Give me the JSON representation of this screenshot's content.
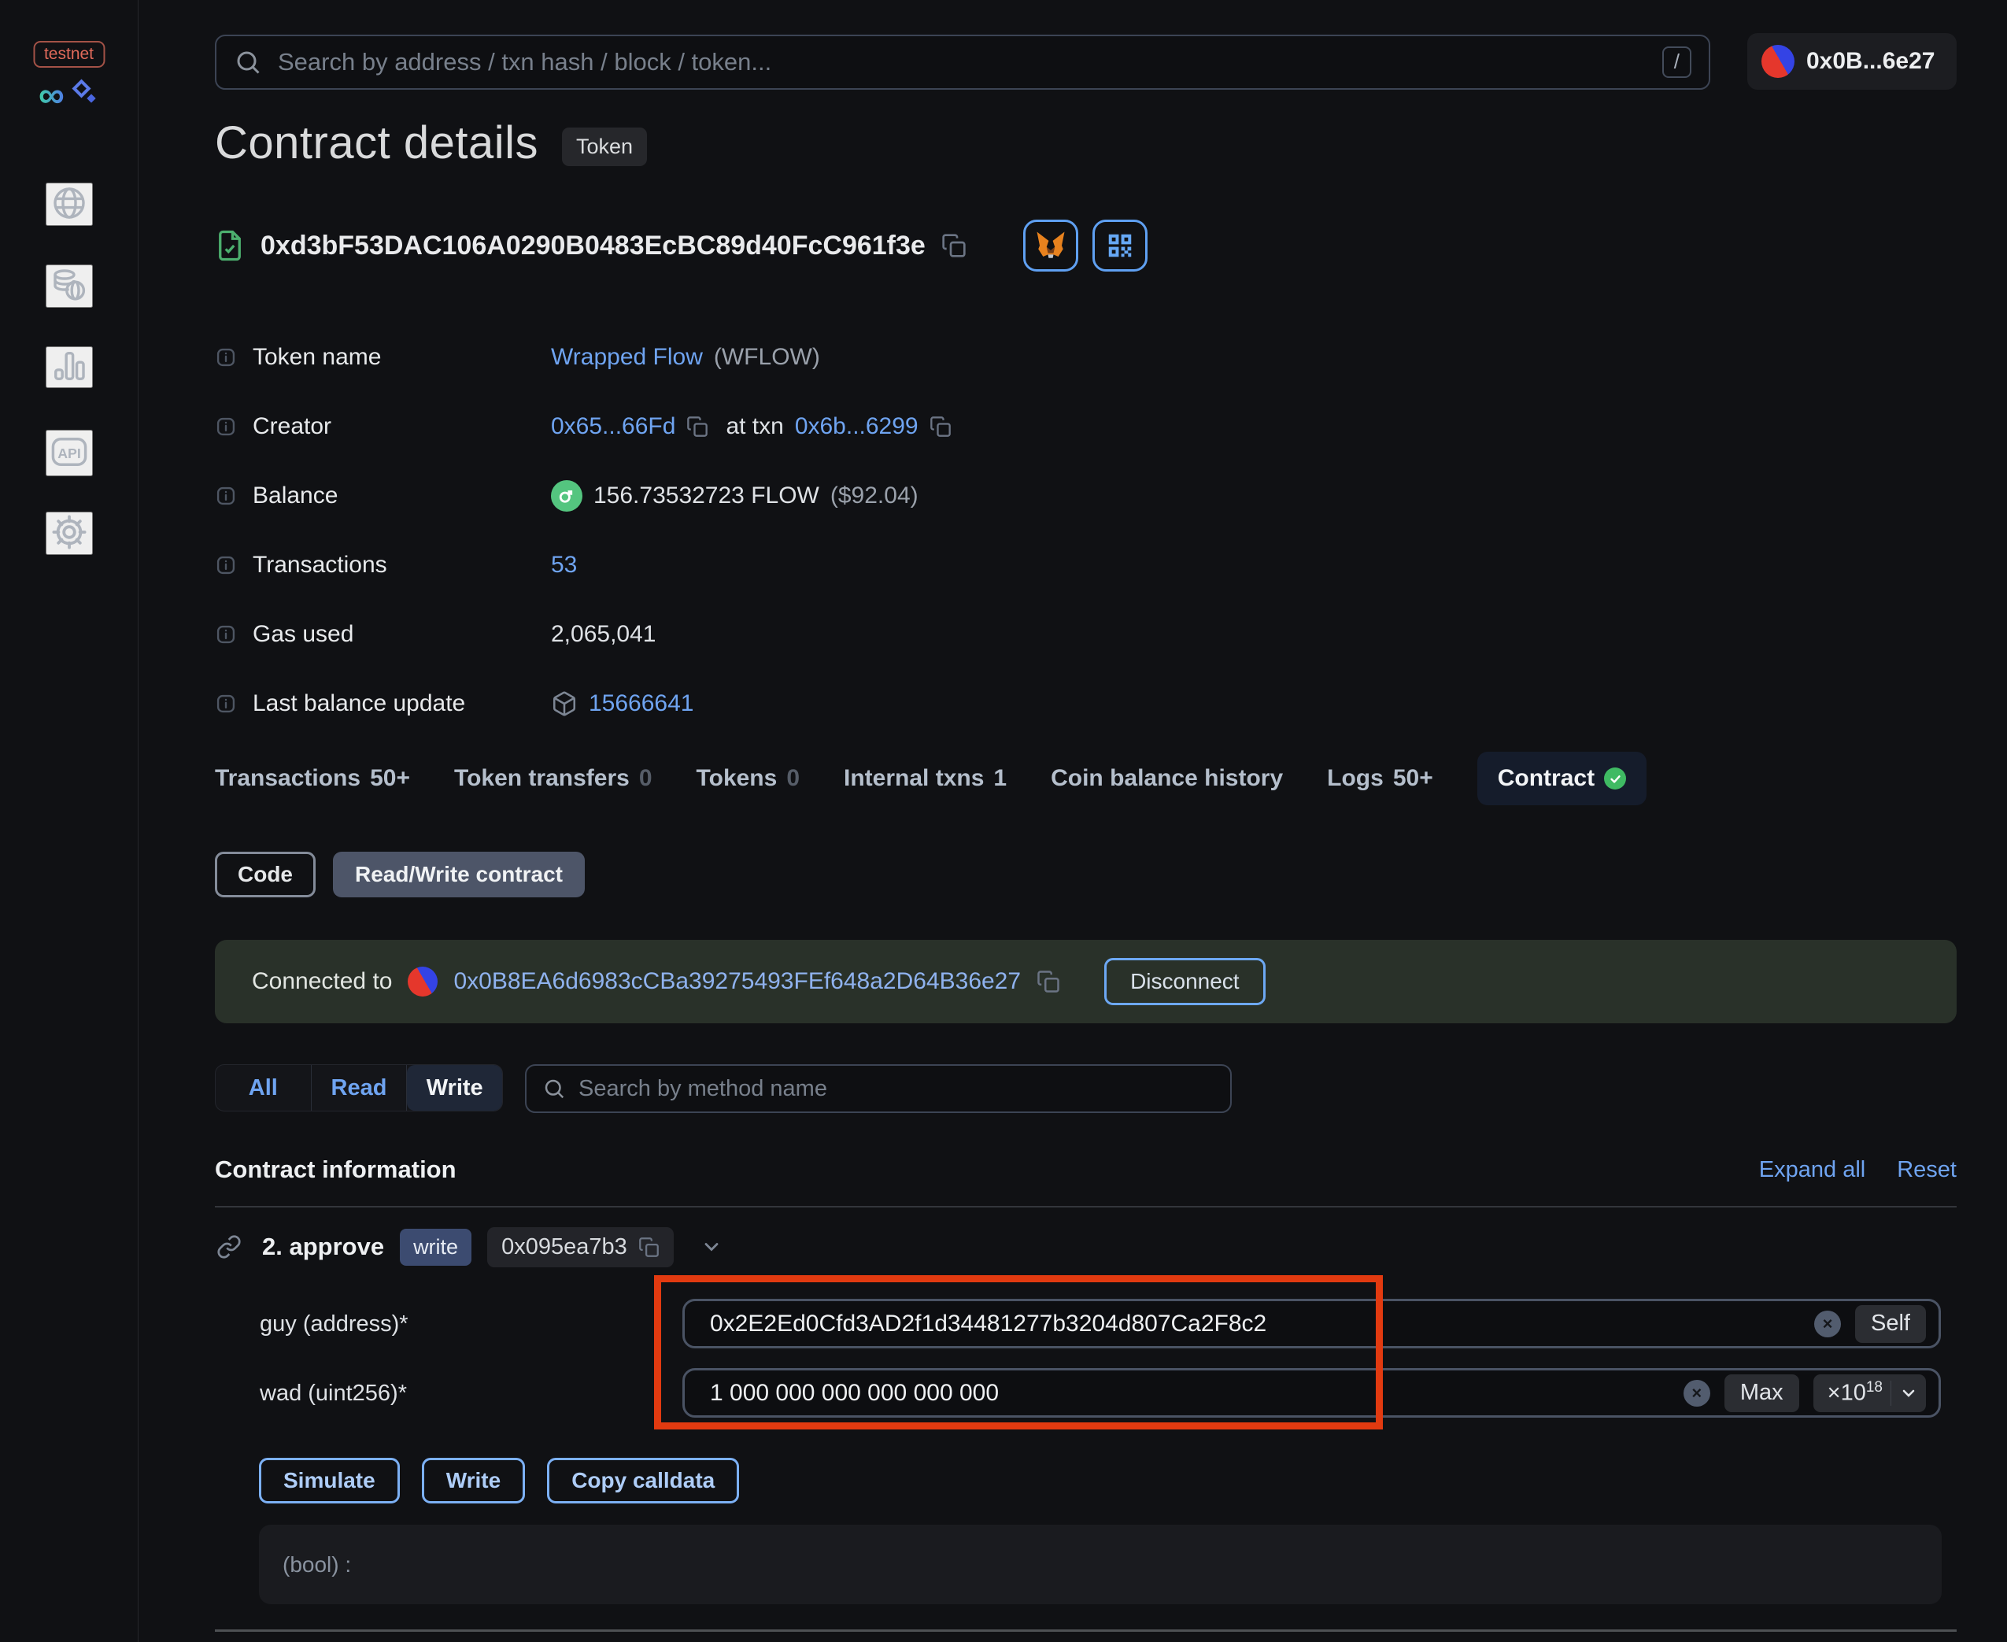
{
  "sidebar": {
    "env_badge": "testnet",
    "nav_icons": [
      "globe-icon",
      "coins-icon",
      "bar-chart-icon",
      "api-icon",
      "gear-icon"
    ]
  },
  "topbar": {
    "search_placeholder": "Search by address / txn hash / block / token...",
    "search_shortcut": "/",
    "account_label": "0x0B...6e27"
  },
  "header": {
    "title": "Contract details",
    "type_badge": "Token",
    "address": "0xd3bF53DAC106A0290B0483EcBC89d40FcC961f3e"
  },
  "info_rows": [
    {
      "label": "Token name",
      "link": "Wrapped Flow",
      "suffix": "(WFLOW)"
    },
    {
      "label": "Creator",
      "creator_link": "0x65...66Fd",
      "mid": "at txn",
      "txn_link": "0x6b...6299"
    },
    {
      "label": "Balance",
      "value": "156.73532723 FLOW",
      "usd": "($92.04)"
    },
    {
      "label": "Transactions",
      "link": "53"
    },
    {
      "label": "Gas used",
      "value": "2,065,041"
    },
    {
      "label": "Last balance update",
      "link": "15666641"
    }
  ],
  "tabs": [
    {
      "label": "Transactions",
      "count": "50+"
    },
    {
      "label": "Token transfers",
      "count": "0"
    },
    {
      "label": "Tokens",
      "count": "0"
    },
    {
      "label": "Internal txns",
      "count": "1"
    },
    {
      "label": "Coin balance history",
      "count": ""
    },
    {
      "label": "Logs",
      "count": "50+"
    },
    {
      "label": "Contract",
      "count": ""
    }
  ],
  "subtabs": {
    "code": "Code",
    "read_write": "Read/Write contract"
  },
  "connection": {
    "prefix": "Connected to",
    "address": "0x0B8EA6d6983cCBa39275493FEf648a2D64B36e27",
    "disconnect": "Disconnect"
  },
  "filter": {
    "all": "All",
    "read": "Read",
    "write": "Write",
    "selected": "Write",
    "search_placeholder": "Search by method name"
  },
  "section": {
    "title": "Contract information",
    "expand_all": "Expand all",
    "reset": "Reset"
  },
  "method": {
    "title": "2. approve",
    "access_badge": "write",
    "selector": "0x095ea7b3",
    "fields": [
      {
        "label": "guy (address)*",
        "value": "0x2E2Ed0Cfd3AD2f1d34481277b3204d807Ca2F8c2",
        "action": "Self"
      },
      {
        "label": "wad (uint256)*",
        "value": "1 000 000 000 000 000 000",
        "action": "Max",
        "multiplier": "×10",
        "exponent": "18"
      }
    ],
    "buttons": [
      "Simulate",
      "Write",
      "Copy calldata"
    ],
    "output_label": "(bool) :"
  },
  "colors": {
    "accent_blue": "#6fa4f1",
    "annotation_red": "#e23a10",
    "banner_green": "#293129",
    "write_badge_navy": "#3c4b70",
    "success_green": "#3fba63",
    "flow_green": "#54c57f"
  }
}
